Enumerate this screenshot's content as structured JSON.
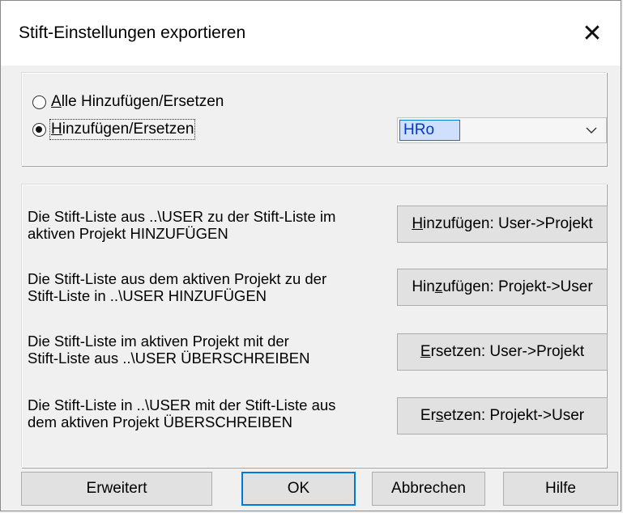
{
  "window": {
    "title": "Stift-Einstellungen exportieren",
    "close_glyph": "✕"
  },
  "mode": {
    "options": [
      {
        "pre": "",
        "mnemonic": "A",
        "post": "lle Hinzufügen/Ersetzen",
        "selected": false
      },
      {
        "pre": "",
        "mnemonic": "H",
        "post": "inzufügen/Ersetzen",
        "selected": true
      }
    ],
    "user_select": {
      "value": "HRo"
    }
  },
  "actions": [
    {
      "description": "Die Stift-Liste aus ..\\USER zu der Stift-Liste im\naktiven Projekt HINZUFÜGEN",
      "button": {
        "pre": "",
        "mnemonic": "H",
        "post": "inzufügen: User->Projekt"
      }
    },
    {
      "description": "Die Stift-Liste aus dem aktiven Projekt zu der\nStift-Liste in ..\\USER HINZUFÜGEN",
      "button": {
        "pre": "Hin",
        "mnemonic": "z",
        "post": "ufügen: Projekt->User"
      }
    },
    {
      "description": "Die Stift-Liste im aktiven Projekt mit der\nStift-Liste aus ..\\USER ÜBERSCHREIBEN",
      "button": {
        "pre": "",
        "mnemonic": "E",
        "post": "rsetzen: User->Projekt"
      }
    },
    {
      "description": "Die Stift-Liste in ..\\USER mit der Stift-Liste aus\ndem aktiven Projekt ÜBERSCHREIBEN",
      "button": {
        "pre": "Er",
        "mnemonic": "s",
        "post": "etzen: Projekt->User"
      }
    }
  ],
  "footer": {
    "extended_label": "Erweitert",
    "ok_label": "OK",
    "cancel_label": "Abbrechen",
    "help_label": "Hilfe"
  },
  "colors": {
    "focus_border": "#0078d7",
    "selection_bg": "#cfe0ff",
    "selection_text": "#0038c8"
  }
}
